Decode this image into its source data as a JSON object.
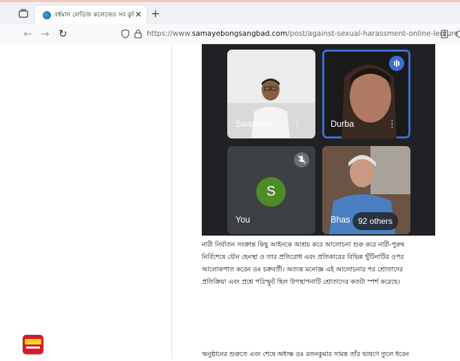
{
  "browser": {
    "tab": {
      "title": "বর্ধমান লেডিজ কলেজের সব কুলিশের প্রতিনিধির মাধ্যমে যৌন"
    },
    "url": {
      "prefix": "https://www.",
      "domain": "samayebongsangbad.com",
      "path": "/post/against-sexual-harassment-online-lecture"
    },
    "icons": [
      "tab-overview-icon",
      "favicon-icon",
      "close-icon",
      "plus-icon",
      "back-arrow-icon",
      "forward-arrow-icon",
      "reload-icon",
      "shield-icon",
      "lock-icon",
      "reader-view-icon"
    ]
  },
  "video_call": {
    "participants": [
      {
        "name": "Swarnam...",
        "active_speaker": false
      },
      {
        "name": "Durba",
        "active_speaker": true,
        "icon": "speaking-icon"
      },
      {
        "name": "You",
        "avatar_letter": "S",
        "muted": true,
        "icon": "mic-off-icon"
      },
      {
        "name": "Bhas",
        "others_count_label": "92 others"
      }
    ],
    "colors": {
      "active_border": "#3b6fd6",
      "avatar": "#4e8a27",
      "background": "#202124"
    }
  },
  "article": {
    "paragraph1": [
      "নারী নির্যাতন সংক্রান্ত কিছু আইনকে আশ্রয় করে আলোচনা শুরু করে নারী-পুরুষ",
      "নির্বিশেষে যৌন হেনস্থা ও তার প্রতিরোধ এবং প্রতিকারের বিভিন্ন খুঁটিনাটির ওপর",
      "আলোকপাত করেন ডঃ চক্রবর্তী। অত্যন্ত মনোজ্ঞ এই আলোচনার পর শ্রোতাদের",
      "প্রতিক্রিয়া এবং প্রশ্নে পরিস্ফুট ছিল উপস্থাপনাটি শ্রোতাদের কতটা স্পর্শ করেছে।"
    ],
    "paragraph2": "অনুষ্ঠানের শুরুতে এবং শেষে অধ্যক্ষ ডঃ রতনকুমার সামন্ত তাঁর ভাষণে তুলে ধরেন"
  },
  "site": {
    "logo": "site-logo"
  }
}
